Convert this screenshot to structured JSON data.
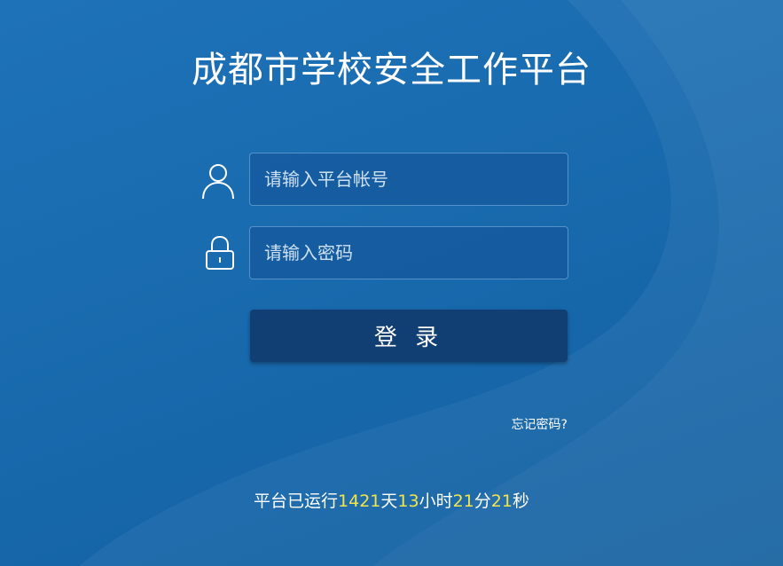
{
  "header": {
    "title": "成都市学校安全工作平台"
  },
  "login": {
    "account_placeholder": "请输入平台帐号",
    "password_placeholder": "请输入密码",
    "submit_label": "登 录",
    "forgot_label": "忘记密码?"
  },
  "icons": {
    "account": "user-icon",
    "password": "lock-icon"
  },
  "uptime": {
    "prefix": "平台已运行",
    "days": "1421",
    "days_unit": "天",
    "hours": "13",
    "hours_unit": "小时",
    "minutes": "21",
    "minutes_unit": "分",
    "seconds": "21",
    "seconds_unit": "秒"
  },
  "colors": {
    "background": "#1a6cb0",
    "button": "#123f73",
    "highlight_number": "#f3e44a"
  }
}
